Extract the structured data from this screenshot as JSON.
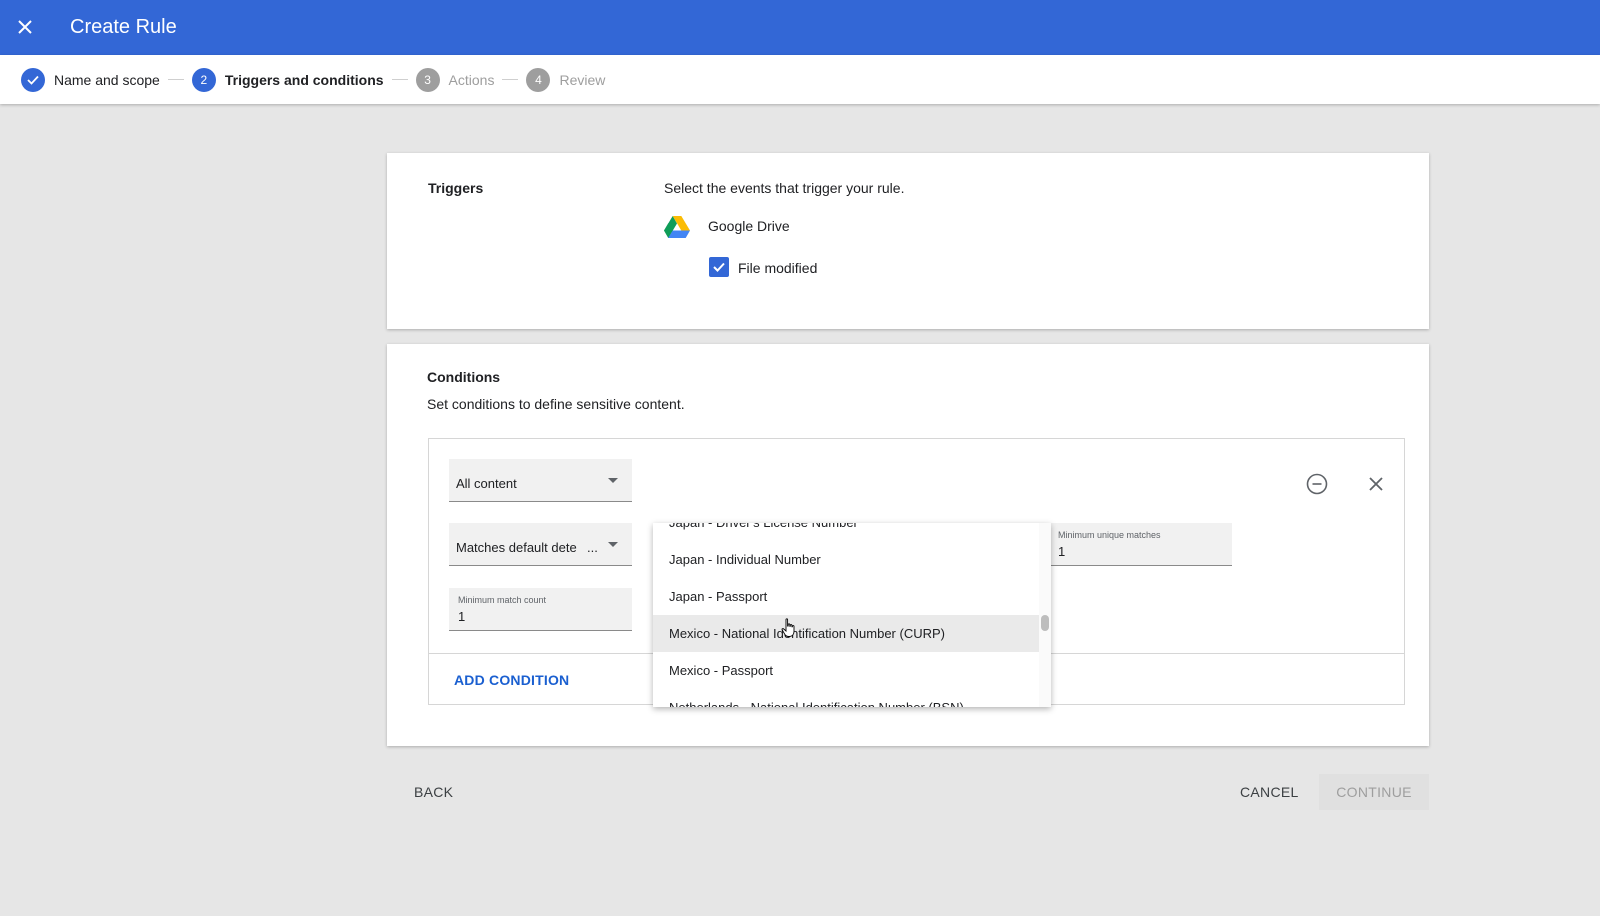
{
  "header": {
    "title": "Create Rule"
  },
  "steps": [
    {
      "number": "",
      "label": "Name and scope"
    },
    {
      "number": "2",
      "label": "Triggers and conditions"
    },
    {
      "number": "3",
      "label": "Actions"
    },
    {
      "number": "4",
      "label": "Review"
    }
  ],
  "triggers": {
    "label": "Triggers",
    "description": "Select the events that trigger your rule.",
    "app": "Google Drive",
    "event_label": "File modified",
    "event_checked": true
  },
  "conditions": {
    "title": "Conditions",
    "description": "Set conditions to define sensitive content.",
    "content_select": "All content",
    "match_select": "Matches default dete",
    "match_ellipsis": "...",
    "min_match_count_label": "Minimum match count",
    "min_match_count": "1",
    "min_unique_label": "Minimum unique matches",
    "min_unique": "1",
    "add_condition": "ADD CONDITION"
  },
  "dropdown": {
    "items": [
      "Japan - Driver's License Number",
      "Japan - Individual Number",
      "Japan - Passport",
      "Mexico - National Identification Number (CURP)",
      "Mexico - Passport",
      "Netherlands - National Identification Number (BSN)"
    ],
    "hovered": "Mexico - National Identification Number (CURP)"
  },
  "footer": {
    "back": "BACK",
    "cancel": "CANCEL",
    "continue": "CONTINUE"
  },
  "colors": {
    "primary": "#3367d6",
    "link": "#1a5fd0"
  }
}
